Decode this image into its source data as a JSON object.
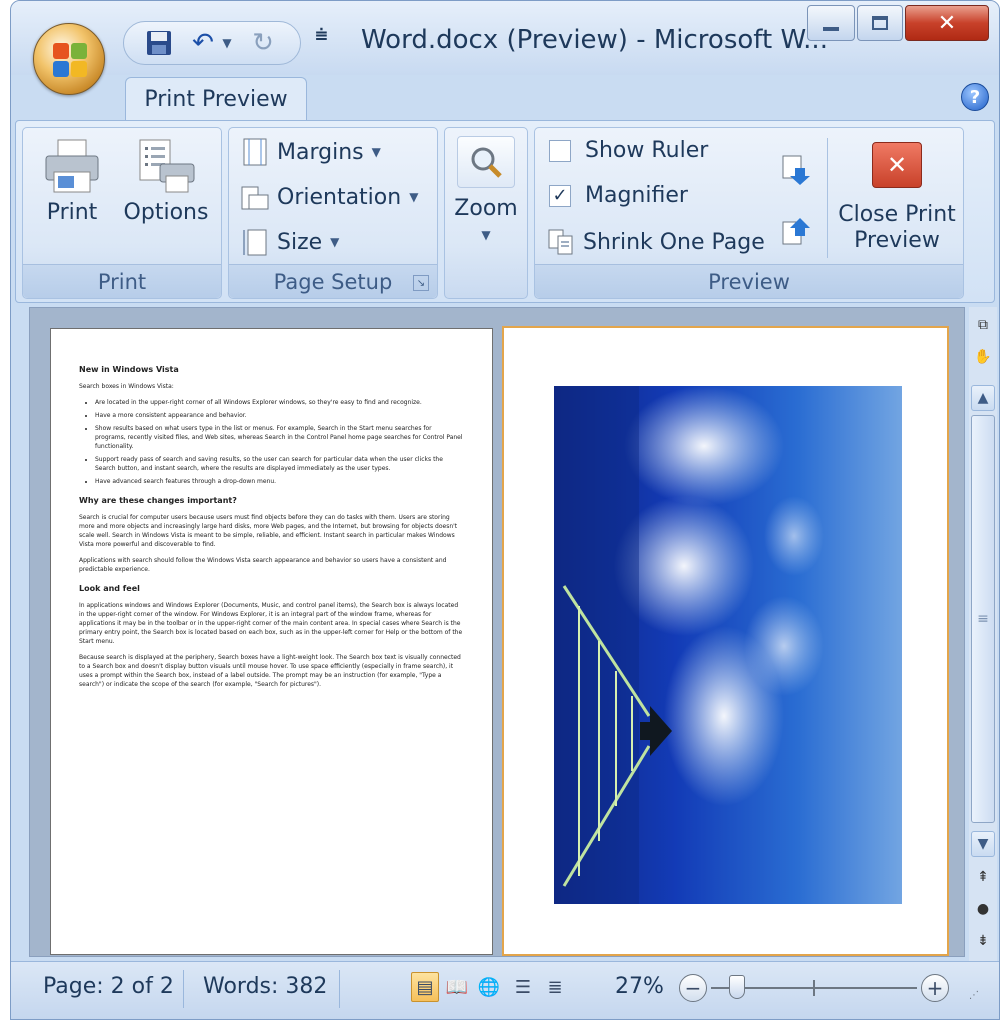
{
  "window": {
    "title": "Word.docx (Preview) - Microsoft W..."
  },
  "qat": {
    "icons": [
      "save-icon",
      "undo-icon",
      "redo-icon",
      "customize-qat-icon"
    ]
  },
  "tabs": [
    {
      "label": "Print Preview",
      "selected": true
    }
  ],
  "ribbon": {
    "print_group": {
      "label": "Print",
      "print_btn": "Print",
      "options_btn": "Options"
    },
    "page_setup": {
      "label": "Page Setup",
      "margins": "Margins",
      "orientation": "Orientation",
      "size": "Size"
    },
    "zoom": {
      "label": "Zoom"
    },
    "preview": {
      "label": "Preview",
      "show_ruler": "Show Ruler",
      "show_ruler_checked": false,
      "magnifier": "Magnifier",
      "magnifier_checked": true,
      "shrink": "Shrink One Page",
      "close_line1": "Close Print",
      "close_line2": "Preview"
    }
  },
  "document": {
    "page1": {
      "heading": "New in Windows Vista",
      "intro": "Search boxes in Windows Vista:",
      "bullets": [
        "Are located in the upper-right corner of all Windows Explorer windows, so they're easy to find and recognize.",
        "Have a more consistent appearance and behavior.",
        "Show results based on what users type in the list or menus. For example, Search in the Start menu searches for programs, recently visited files, and Web sites, whereas Search in the Control Panel home page searches for Control Panel functionality.",
        "Support ready pass of search and saving results, so the user can search for particular data when the user clicks the Search button, and instant search, where the results are displayed immediately as the user types.",
        "Have advanced search features through a drop-down menu."
      ],
      "h2a": "Why are these changes important?",
      "para1": "Search is crucial for computer users because users must find objects before they can do tasks with them. Users are storing more and more objects and increasingly large hard disks, more Web pages, and the Internet, but browsing for objects doesn't scale well. Search in Windows Vista is meant to be simple, reliable, and efficient. Instant search in particular makes Windows Vista more powerful and discoverable to find.",
      "para2": "Applications with search should follow the Windows Vista search appearance and behavior so users have a consistent and predictable experience.",
      "h2b": "Look and feel",
      "para3": "In applications windows and Windows Explorer (Documents, Music, and control panel items), the Search box is always located in the upper-right corner of the window. For Windows Explorer, it is an integral part of the window frame, whereas for applications it may be in the toolbar or in the upper-right corner of the main content area. In special cases where Search is the primary entry point, the Search box is located based on each box, such as in the upper-left corner for Help or the bottom of the Start menu.",
      "para4": "Because search is displayed at the periphery, Search boxes have a light-weight look. The Search box text is visually connected to a Search box and doesn't display button visuals until mouse hover. To use space efficiently (especially in frame search), it uses a prompt within the Search box, instead of a label outside. The prompt may be an instruction (for example, \"Type a search\") or indicate the scope of the search (for example, \"Search for pictures\")."
    }
  },
  "status": {
    "page": "Page: 2 of 2",
    "words": "Words: 382",
    "zoom": "27%",
    "zoom_percent": 27
  },
  "colors": {
    "accent": "#1e395b",
    "ribbon_bg": "#d2e2f5",
    "close_red": "#c8412a",
    "page_selected": "#e3a54b"
  }
}
